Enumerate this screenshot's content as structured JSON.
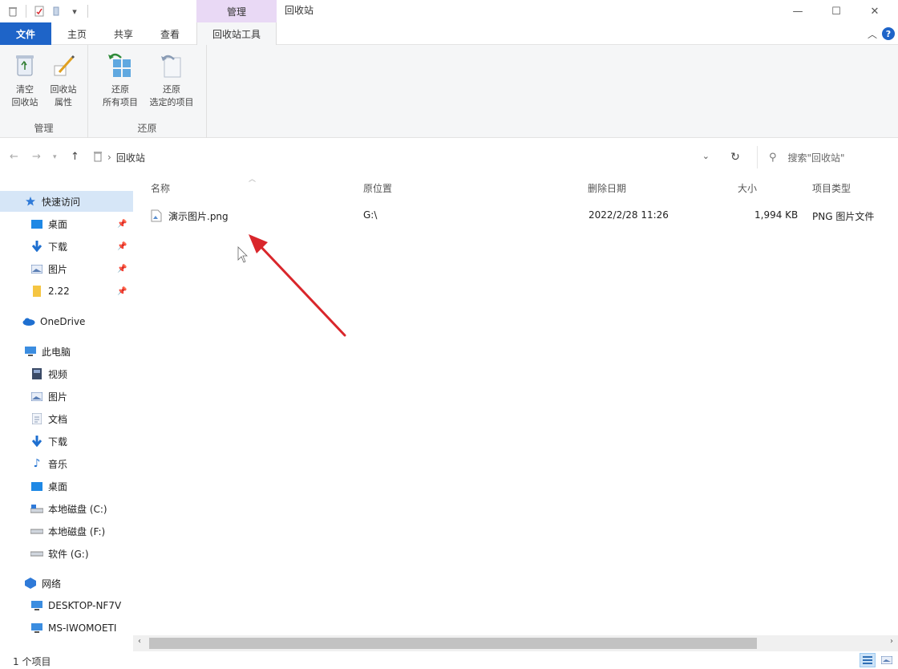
{
  "window": {
    "title": "回收站",
    "context_group": "管理"
  },
  "tabs": {
    "file": "文件",
    "home": "主页",
    "share": "共享",
    "view": "查看",
    "recycle_tools": "回收站工具"
  },
  "ribbon": {
    "groups": [
      {
        "label": "管理",
        "buttons": [
          {
            "label": "清空\n回收站",
            "icon": "empty-recycle-bin-icon"
          },
          {
            "label": "回收站\n属性",
            "icon": "recycle-bin-properties-icon"
          }
        ]
      },
      {
        "label": "还原",
        "buttons": [
          {
            "label": "还原\n所有项目",
            "icon": "restore-all-icon"
          },
          {
            "label": "还原\n选定的项目",
            "icon": "restore-selected-icon"
          }
        ]
      }
    ]
  },
  "address": {
    "location": "回收站",
    "search_placeholder": "搜索\"回收站\""
  },
  "nav": {
    "quick_access": "快速访问",
    "quick_items": [
      "桌面",
      "下载",
      "图片",
      "2.22"
    ],
    "onedrive": "OneDrive",
    "this_pc": "此电脑",
    "pc_items": [
      "视频",
      "图片",
      "文档",
      "下载",
      "音乐",
      "桌面",
      "本地磁盘 (C:)",
      "本地磁盘 (F:)",
      "软件 (G:)"
    ],
    "network": "网络",
    "network_items": [
      "DESKTOP-NF7V",
      "MS-IWOMOETI"
    ]
  },
  "columns": [
    "名称",
    "原位置",
    "删除日期",
    "大小",
    "项目类型"
  ],
  "files": [
    {
      "name": "演示图片.png",
      "original_location": "G:\\",
      "deleted": "2022/2/28 11:26",
      "size": "1,994 KB",
      "type": "PNG 图片文件"
    }
  ],
  "status": {
    "count_text": "1 个项目"
  },
  "colors": {
    "accent": "#1e64c8",
    "context_tab": "#e9d9f5",
    "selection": "#d6e6f7",
    "arrow": "#d9262b"
  }
}
